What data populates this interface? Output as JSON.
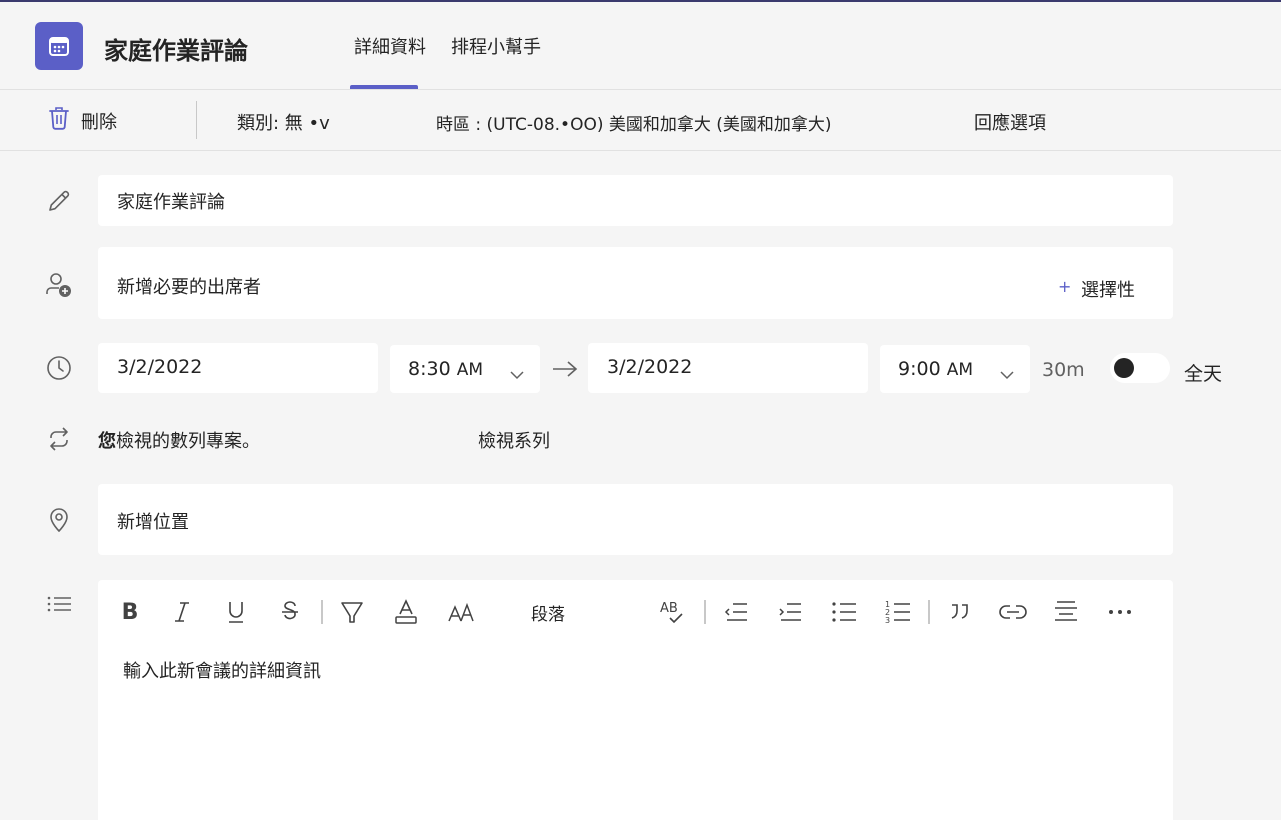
{
  "header": {
    "title": "家庭作業評論",
    "tabs": [
      {
        "label": "詳細資料",
        "active": true
      },
      {
        "label": "排程小幫手",
        "active": false
      }
    ],
    "accent_color": "#5b5fc7"
  },
  "toolbar": {
    "delete_label": "刪除",
    "category_label": "類別: 無 •v",
    "timezone_label": "時區 :  (UTC-08.•OO) 美國和加拿大 (美國和加拿大)",
    "response_options_label": "回應選項"
  },
  "form": {
    "title_value": "家庭作業評論",
    "attendees_placeholder": "新增必要的出席者",
    "optional_label": "選擇性",
    "start_date": "3/2/2022",
    "start_time": "8:30",
    "start_ampm": "AM",
    "end_date": "3/2/2022",
    "end_time": "9:00",
    "end_ampm": "AM",
    "duration": "30m",
    "all_day_label": "全天",
    "all_day_on": false,
    "series_bold": "您",
    "series_text": "檢視的數列專案。",
    "view_series_label": "檢視系列",
    "location_placeholder": "新增位置",
    "editor": {
      "paragraph_label": "段落",
      "placeholder": "輸入此新會議的詳細資訊"
    }
  }
}
